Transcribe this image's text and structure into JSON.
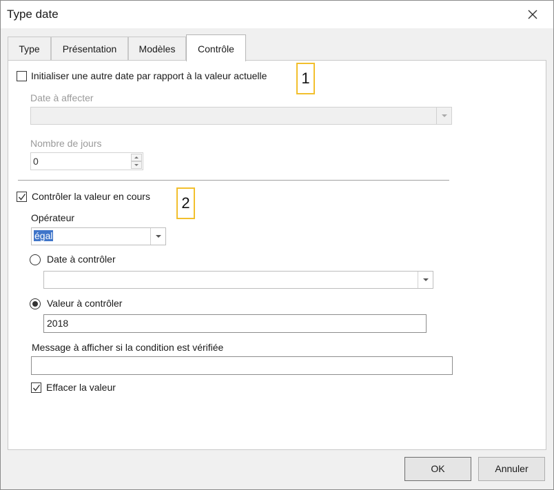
{
  "window": {
    "title": "Type date"
  },
  "tabs": [
    {
      "label": "Type",
      "active": false
    },
    {
      "label": "Présentation",
      "active": false
    },
    {
      "label": "Modèles",
      "active": false
    },
    {
      "label": "Contrôle",
      "active": true
    }
  ],
  "section1": {
    "checkbox_label": "Initialiser une autre date par rapport à la valeur actuelle",
    "checked": false,
    "date_label": "Date à affecter",
    "date_value": "",
    "days_label": "Nombre de jours",
    "days_value": "0",
    "callout": "1"
  },
  "section2": {
    "checkbox_label": "Contrôler la valeur en cours",
    "checked": true,
    "operator_label": "Opérateur",
    "operator_value": "égal",
    "radio_date_label": "Date à contrôler",
    "radio_date_value": "",
    "radio_value_label": "Valeur à contrôler",
    "value_to_check": "2018",
    "message_label": "Message à afficher si la condition est vérifiée",
    "message_value": "",
    "clear_label": "Effacer la valeur",
    "clear_checked": true,
    "callout": "2"
  },
  "buttons": {
    "ok": "OK",
    "cancel": "Annuler"
  },
  "colors": {
    "callout_border": "#f2bf2c",
    "selection": "#3f75c9"
  }
}
